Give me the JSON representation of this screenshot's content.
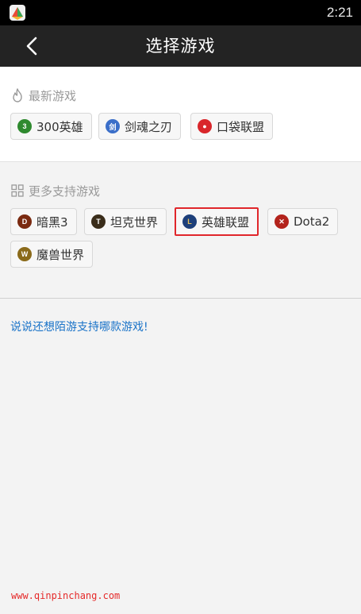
{
  "status_bar": {
    "time": "2:21"
  },
  "nav": {
    "title": "选择游戏"
  },
  "sections": {
    "latest": {
      "header": "最新游戏",
      "games": [
        "300英雄",
        "剑魂之刃",
        "口袋联盟"
      ]
    },
    "more": {
      "header": "更多支持游戏",
      "games": [
        "暗黑3",
        "坦克世界",
        "英雄联盟",
        "Dota2",
        "魔兽世界"
      ],
      "selected": "英雄联盟"
    }
  },
  "feedback_link": "说说还想陌游支持哪款游戏!",
  "watermark": "www.qinpinchang.com",
  "colors": {
    "status_bar": "#000000",
    "nav_bar": "#232323",
    "selected_border": "#e0262b",
    "link": "#1a73c8",
    "watermark": "#e52a2a"
  }
}
